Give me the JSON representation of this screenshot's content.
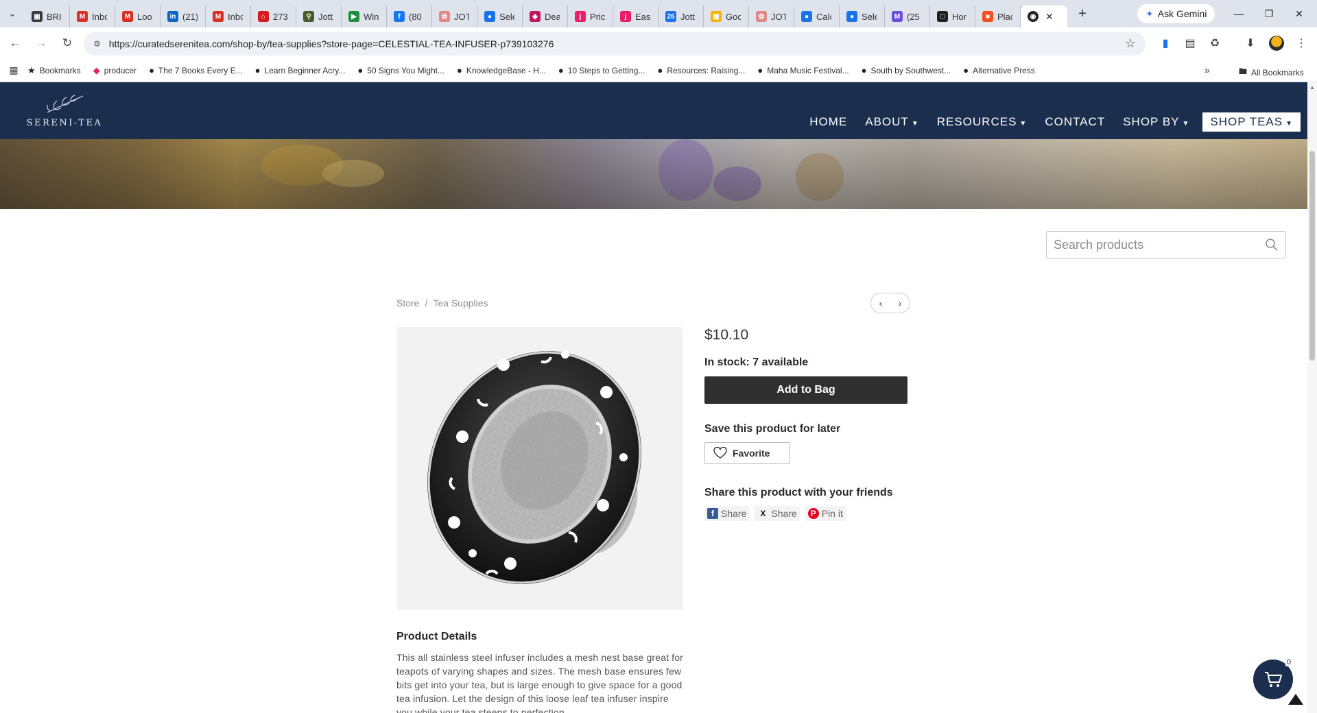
{
  "browser": {
    "tabs": [
      {
        "title": "BRI",
        "icon": "bag-icon",
        "color": "#3a3a3a"
      },
      {
        "title": "Inbo",
        "icon": "gmail-icon",
        "color": "#d93025"
      },
      {
        "title": "Loo",
        "icon": "gmail-icon",
        "color": "#d93025"
      },
      {
        "title": "(21)",
        "icon": "linkedin-icon",
        "color": "#0a66c2"
      },
      {
        "title": "Inbo",
        "icon": "gmail-icon",
        "color": "#d93025"
      },
      {
        "title": "273",
        "icon": "home-icon",
        "color": "#d11d1d"
      },
      {
        "title": "Jott",
        "icon": "pin-icon",
        "color": "#4a5a2a"
      },
      {
        "title": "Win",
        "icon": "meet-icon",
        "color": "#1e8e3e"
      },
      {
        "title": "(80",
        "icon": "facebook-icon",
        "color": "#1877f2"
      },
      {
        "title": "JOT",
        "icon": "brain-icon",
        "color": "#e08a8a"
      },
      {
        "title": "Sele",
        "icon": "globe-icon",
        "color": "#1a73e8"
      },
      {
        "title": "Dea",
        "icon": "tag-icon",
        "color": "#c2185b"
      },
      {
        "title": "Pric",
        "icon": "j-icon",
        "color": "#e91e63"
      },
      {
        "title": "Eas",
        "icon": "j-icon",
        "color": "#e91e63"
      },
      {
        "title": "Jott",
        "icon": "calendar-icon",
        "color": "#1a73e8"
      },
      {
        "title": "Goo",
        "icon": "slides-icon",
        "color": "#f4b400"
      },
      {
        "title": "JOT",
        "icon": "brain-icon",
        "color": "#e08a8a"
      },
      {
        "title": "Calc",
        "icon": "globe-icon",
        "color": "#1a73e8"
      },
      {
        "title": "Sele",
        "icon": "globe-icon",
        "color": "#1a73e8"
      },
      {
        "title": "(25",
        "icon": "mail-icon",
        "color": "#6b4fd8"
      },
      {
        "title": "Hor",
        "icon": "square-icon",
        "color": "#222222"
      },
      {
        "title": "Plac",
        "icon": "orange-icon",
        "color": "#f4511e"
      }
    ],
    "active_tab": {
      "icon": "site-icon"
    },
    "new_tab_glyph": "+",
    "gemini_label": "Ask Gemini",
    "url": "https://curatedserenitea.com/shop-by/tea-supplies?store-page=CELESTIAL-TEA-INFUSER-p739103276",
    "bookmarks": [
      {
        "label": "Bookmarks",
        "icon": "star-icon"
      },
      {
        "label": "producer",
        "icon": "producer-icon"
      },
      {
        "label": "The 7 Books Every E...",
        "icon": "globe-icon"
      },
      {
        "label": "Learn Beginner Acry...",
        "icon": "globe-icon"
      },
      {
        "label": "50 Signs You Might...",
        "icon": "globe-icon"
      },
      {
        "label": "KnowledgeBase - H...",
        "icon": "globe-icon"
      },
      {
        "label": "10 Steps to Getting...",
        "icon": "globe-icon"
      },
      {
        "label": "Resources: Raising...",
        "icon": "globe-icon"
      },
      {
        "label": "Maha Music Festival...",
        "icon": "globe-icon"
      },
      {
        "label": "South by Southwest...",
        "icon": "globe-icon"
      },
      {
        "label": "Alternative Press",
        "icon": "globe-icon"
      }
    ],
    "all_bookmarks_label": "All Bookmarks"
  },
  "site": {
    "logo_text": "SERENI-TEA",
    "nav": [
      {
        "label": "HOME",
        "caret": false
      },
      {
        "label": "ABOUT",
        "caret": true
      },
      {
        "label": "RESOURCES",
        "caret": true
      },
      {
        "label": "CONTACT",
        "caret": false
      },
      {
        "label": "SHOP BY",
        "caret": true
      },
      {
        "label": "SHOP TEAS",
        "caret": true
      }
    ],
    "search_placeholder": "Search products",
    "breadcrumb": {
      "store": "Store",
      "separator": "/",
      "category": "Tea Supplies"
    },
    "product": {
      "price": "$10.10",
      "stock": "In stock: 7 available",
      "add_to_bag": "Add to Bag",
      "save_heading": "Save this product for later",
      "favorite_label": "Favorite",
      "share_heading": "Share this product with your friends",
      "share_buttons": [
        {
          "label": "Share",
          "icon": "facebook-icon"
        },
        {
          "label": "Share",
          "icon": "x-icon"
        },
        {
          "label": "Pin it",
          "icon": "pinterest-icon"
        }
      ],
      "details_heading": "Product Details",
      "details_text": "This all stainless steel infuser includes a mesh nest base great for teapots of varying shapes and sizes. The mesh base ensures few bits get into your tea, but is large enough to give space for a good tea infusion. Let the design of this loose leaf tea infuser inspire you while your tea steeps to perfection."
    },
    "cart_count": "0",
    "colors": {
      "header": "#1b2e4e",
      "button": "#303030",
      "text_muted": "#8e8e8e"
    }
  }
}
